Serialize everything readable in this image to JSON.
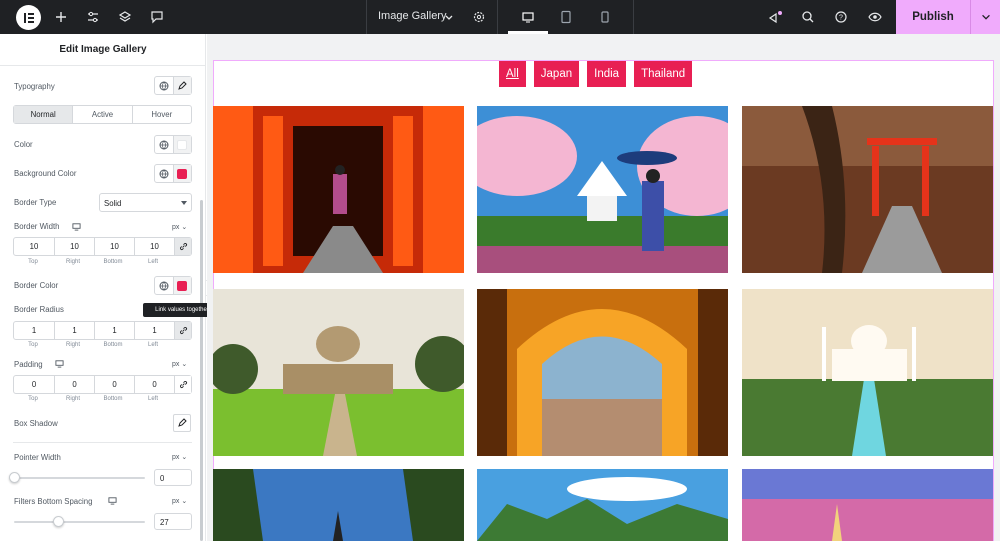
{
  "topbar": {
    "logo_icon": "elementor-logo-icon",
    "document_title": "Image Gallery",
    "publish_label": "Publish",
    "icons": [
      "plus-icon",
      "sliders-icon",
      "layers-icon",
      "comment-icon",
      "settings-gear-icon",
      "desktop-icon",
      "tablet-icon",
      "mobile-icon",
      "whats-new-icon",
      "search-icon",
      "help-icon",
      "preview-eye-icon",
      "chevron-down-icon"
    ]
  },
  "panel": {
    "title": "Edit Image Gallery",
    "typography_label": "Typography",
    "state_tabs": [
      "Normal",
      "Active",
      "Hover"
    ],
    "color_label": "Color",
    "background_color_label": "Background Color",
    "border_type_label": "Border Type",
    "border_type_value": "Solid",
    "border_width_label": "Border Width",
    "border_width_unit": "px",
    "border_width": {
      "top": "10",
      "right": "10",
      "bottom": "10",
      "left": "10"
    },
    "dim_labels": {
      "top": "Top",
      "right": "Right",
      "bottom": "Bottom",
      "left": "Left"
    },
    "border_color_label": "Border Color",
    "tooltip": "Link values together",
    "border_radius_label": "Border Radius",
    "border_radius": {
      "top": "1",
      "right": "1",
      "bottom": "1",
      "left": "1"
    },
    "padding_label": "Padding",
    "padding_unit": "px",
    "padding": {
      "top": "0",
      "right": "0",
      "bottom": "0",
      "left": "0"
    },
    "box_shadow_label": "Box Shadow",
    "pointer_width_label": "Pointer Width",
    "pointer_width_unit": "px",
    "pointer_width_value": "0",
    "filters_spacing_label": "Filters Bottom Spacing",
    "filters_spacing_unit": "px",
    "filters_spacing_value": "27",
    "colors": {
      "accent": "#e81f53",
      "text_color_swatch": "#ffffff"
    }
  },
  "canvas": {
    "filters": [
      "All",
      "Japan",
      "India",
      "Thailand"
    ],
    "active_filter": "All",
    "filter_color": "#e81f53"
  }
}
